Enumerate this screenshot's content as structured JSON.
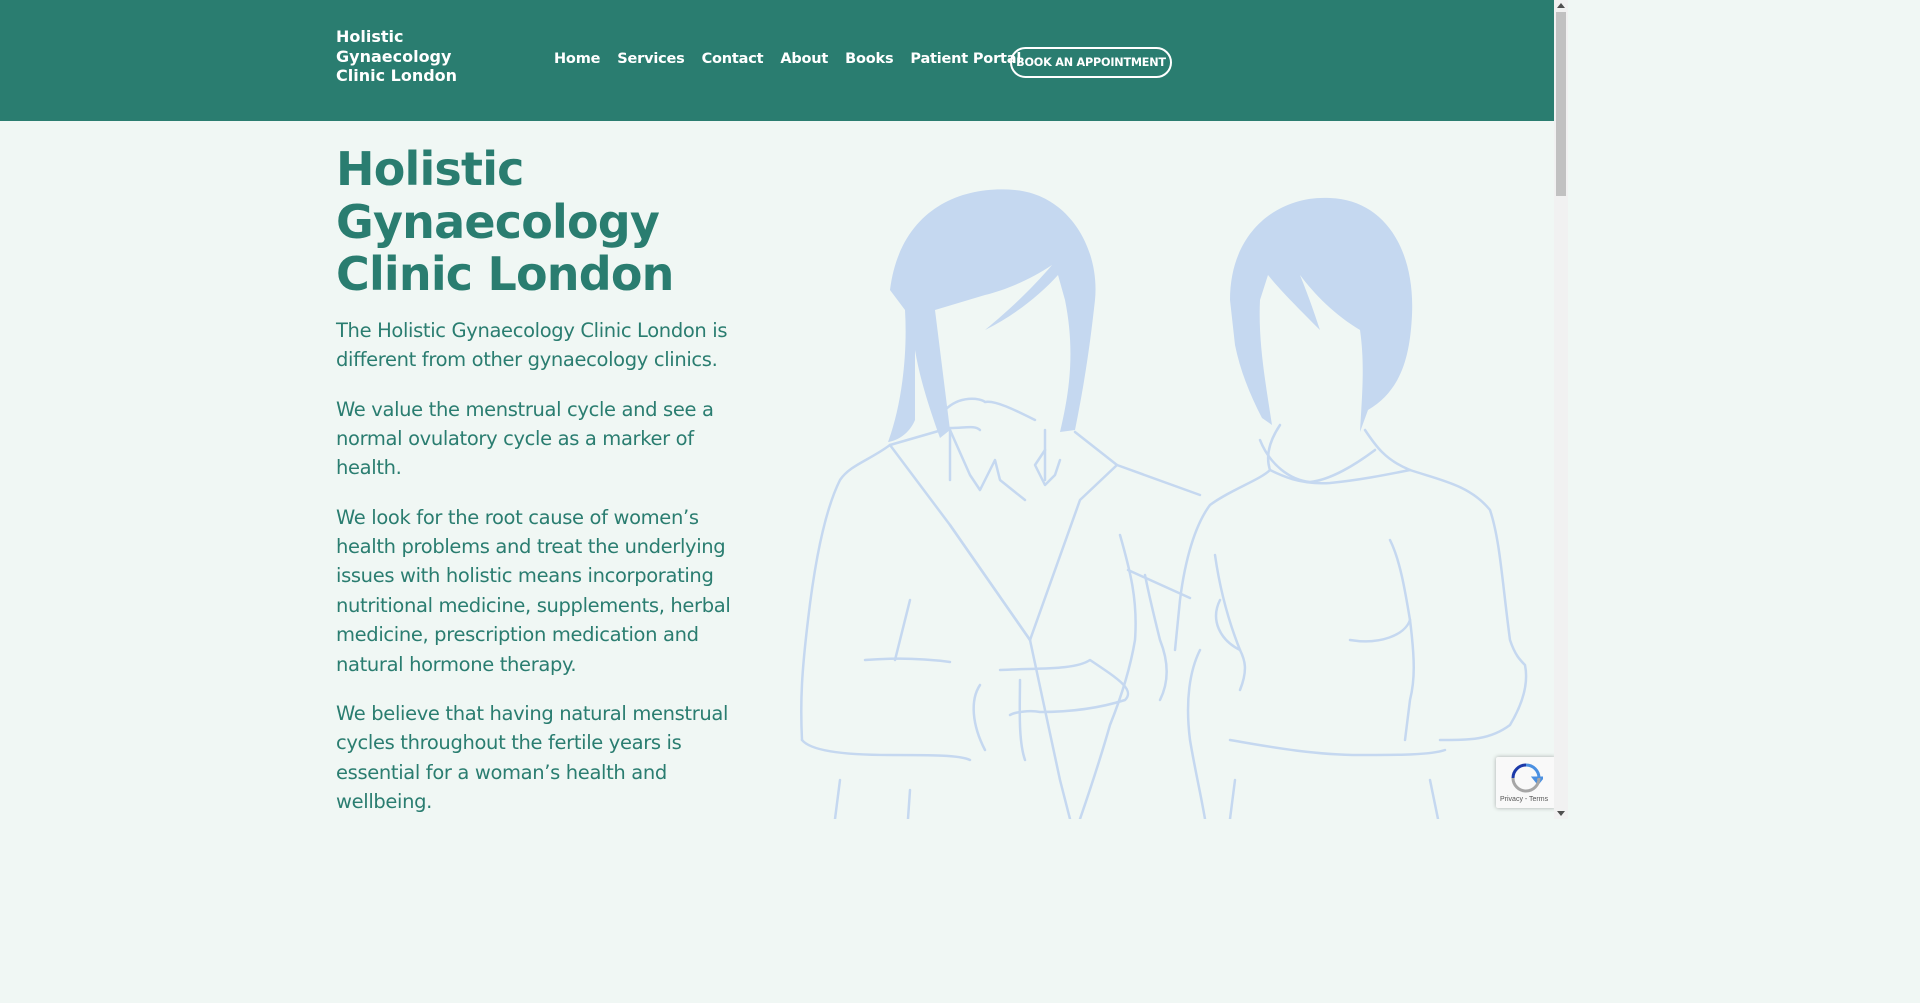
{
  "header": {
    "logo_lines": [
      "Holistic",
      "Gynaecology",
      "Clinic London"
    ],
    "nav": [
      {
        "label": "Home"
      },
      {
        "label": "Services"
      },
      {
        "label": "Contact"
      },
      {
        "label": "About"
      },
      {
        "label": "Books"
      },
      {
        "label": "Patient Portal"
      }
    ],
    "cta_label": "BOOK AN APPOINTMENT"
  },
  "hero": {
    "title_lines": [
      "Holistic",
      "Gynaecology",
      "Clinic London"
    ],
    "paragraphs": [
      "The Holistic Gynaecology Clinic London is different from other gynaecology clinics.",
      "We value the menstrual cycle and see a normal ovulatory cycle as a marker of health.",
      "We look for the root cause of women’s health problems and treat the underlying issues with holistic means incorporating nutritional medicine, supplements, herbal medicine, prescription medication and natural hormone therapy.",
      "We believe that having natural menstrual cycles throughout the fertile years is essential for a woman’s health and wellbeing."
    ]
  },
  "recaptcha": {
    "label": "Privacy - Terms"
  },
  "colors": {
    "brand": "#2a7d70",
    "background": "#f0f7f4",
    "illustration": "#c5d8f0"
  },
  "icons": {
    "illustration": "two-women-illustration",
    "recaptcha": "recaptcha-icon"
  }
}
